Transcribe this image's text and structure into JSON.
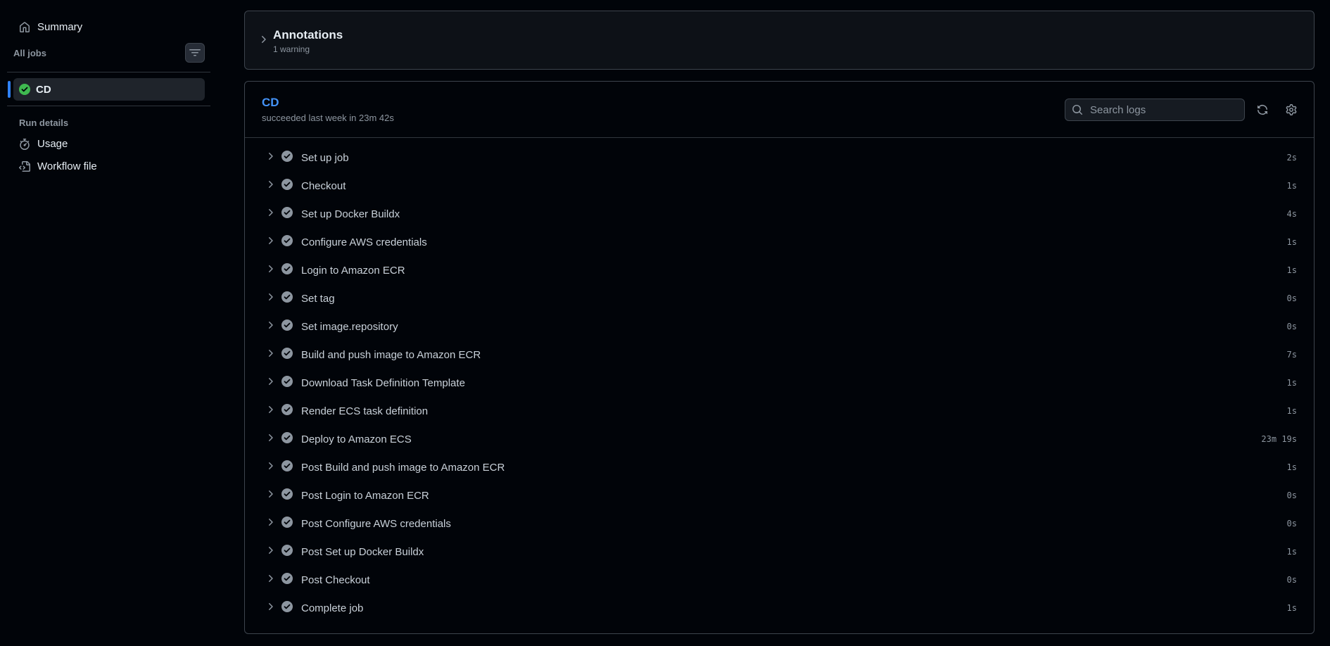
{
  "sidebar": {
    "summary_label": "Summary",
    "all_jobs_label": "All jobs",
    "jobs": [
      {
        "label": "CD",
        "status": "success"
      }
    ],
    "run_details_label": "Run details",
    "usage_label": "Usage",
    "workflow_file_label": "Workflow file"
  },
  "annotations": {
    "title": "Annotations",
    "subtitle": "1 warning"
  },
  "job": {
    "title": "CD",
    "subtitle": "succeeded last week in 23m 42s",
    "search_placeholder": "Search logs",
    "steps": [
      {
        "name": "Set up job",
        "duration": "2s"
      },
      {
        "name": "Checkout",
        "duration": "1s"
      },
      {
        "name": "Set up Docker Buildx",
        "duration": "4s"
      },
      {
        "name": "Configure AWS credentials",
        "duration": "1s"
      },
      {
        "name": "Login to Amazon ECR",
        "duration": "1s"
      },
      {
        "name": "Set tag",
        "duration": "0s"
      },
      {
        "name": "Set image.repository",
        "duration": "0s"
      },
      {
        "name": "Build and push image to Amazon ECR",
        "duration": "7s"
      },
      {
        "name": "Download Task Definition Template",
        "duration": "1s"
      },
      {
        "name": "Render ECS task definition",
        "duration": "1s"
      },
      {
        "name": "Deploy to Amazon ECS",
        "duration": "23m 19s"
      },
      {
        "name": "Post Build and push image to Amazon ECR",
        "duration": "1s"
      },
      {
        "name": "Post Login to Amazon ECR",
        "duration": "0s"
      },
      {
        "name": "Post Configure AWS credentials",
        "duration": "0s"
      },
      {
        "name": "Post Set up Docker Buildx",
        "duration": "1s"
      },
      {
        "name": "Post Checkout",
        "duration": "0s"
      },
      {
        "name": "Complete job",
        "duration": "1s"
      }
    ]
  },
  "colors": {
    "success": "#3fb950",
    "step_check": "#8d96a0",
    "accent": "#4493f8"
  }
}
